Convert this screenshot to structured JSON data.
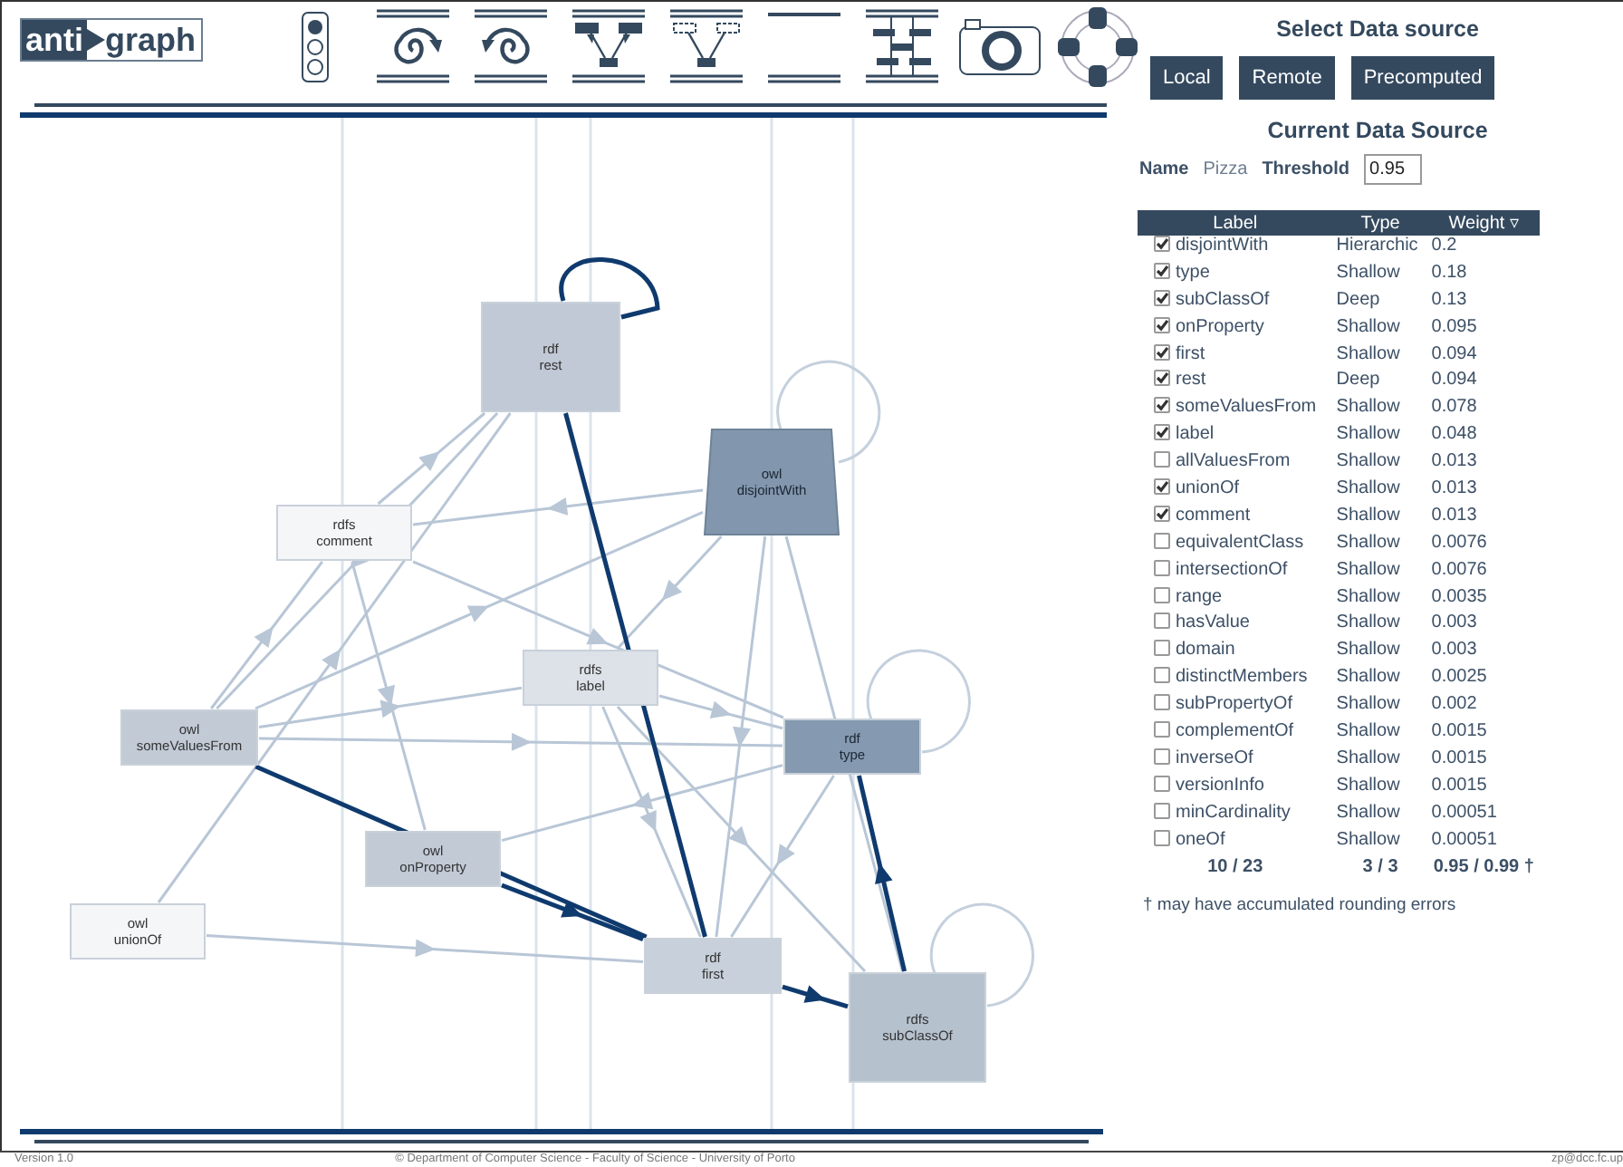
{
  "logo": {
    "parts": [
      "anti",
      "graph"
    ]
  },
  "toolbar": [
    {
      "kind": "traffic-light"
    },
    {
      "kind": "redo"
    },
    {
      "kind": "undo"
    },
    {
      "kind": "expand"
    },
    {
      "kind": "collapse"
    },
    {
      "kind": "blank"
    },
    {
      "kind": "layout"
    },
    {
      "kind": "camera"
    },
    {
      "kind": "lifebuoy"
    }
  ],
  "graph": {
    "nodes": [
      {
        "prefix": "rdf",
        "name": "rest",
        "kind": "rect",
        "color": "#c0c9d5"
      },
      {
        "prefix": "owl",
        "name": "disjointWith",
        "kind": "trapezoid",
        "color": "#8296ad"
      },
      {
        "prefix": "rdfs",
        "name": "comment",
        "kind": "rect",
        "color": "#f5f6f8"
      },
      {
        "prefix": "rdfs",
        "name": "label",
        "kind": "rect",
        "color": "#dde2e8"
      },
      {
        "prefix": "owl",
        "name": "someValuesFrom",
        "kind": "rect",
        "color": "#c2cad6"
      },
      {
        "prefix": "rdf",
        "name": "type",
        "kind": "rect",
        "color": "#8599b0"
      },
      {
        "prefix": "owl",
        "name": "onProperty",
        "kind": "rect",
        "color": "#c2cad6"
      },
      {
        "prefix": "owl",
        "name": "unionOf",
        "kind": "rect",
        "color": "#f5f6f8"
      },
      {
        "prefix": "rdf",
        "name": "first",
        "kind": "rect",
        "color": "#c8d0db"
      },
      {
        "prefix": "rdfs",
        "name": "subClassOf",
        "kind": "rect",
        "color": "#b6c1ce"
      }
    ]
  },
  "data_source": {
    "title": "Select Data source",
    "buttons": [
      "Local",
      "Remote",
      "Precomputed"
    ],
    "current_title": "Current Data Source",
    "name_label": "Name",
    "name_value": "Pizza",
    "threshold_label": "Threshold",
    "threshold_value": "0.95"
  },
  "table": {
    "columns": [
      "Label",
      "Type",
      "Weight ▿"
    ],
    "rows": [
      {
        "label": "disjointWith",
        "checked": true,
        "type": "Hierarchic",
        "weight": "0.2"
      },
      {
        "label": "type",
        "checked": true,
        "type": "Shallow",
        "weight": "0.18"
      },
      {
        "label": "subClassOf",
        "checked": true,
        "type": "Deep",
        "weight": "0.13"
      },
      {
        "label": "onProperty",
        "checked": true,
        "type": "Shallow",
        "weight": "0.095"
      },
      {
        "label": "first",
        "checked": true,
        "type": "Shallow",
        "weight": "0.094"
      },
      {
        "label": "rest",
        "checked": true,
        "type": "Deep",
        "weight": "0.094"
      },
      {
        "label": "someValuesFrom",
        "checked": true,
        "type": "Shallow",
        "weight": "0.078"
      },
      {
        "label": "label",
        "checked": true,
        "type": "Shallow",
        "weight": "0.048"
      },
      {
        "label": "allValuesFrom",
        "checked": false,
        "type": "Shallow",
        "weight": "0.013"
      },
      {
        "label": "unionOf",
        "checked": true,
        "type": "Shallow",
        "weight": "0.013"
      },
      {
        "label": "comment",
        "checked": true,
        "type": "Shallow",
        "weight": "0.013"
      },
      {
        "label": "equivalentClass",
        "checked": false,
        "type": "Shallow",
        "weight": "0.0076"
      },
      {
        "label": "intersectionOf",
        "checked": false,
        "type": "Shallow",
        "weight": "0.0076"
      },
      {
        "label": "range",
        "checked": false,
        "type": "Shallow",
        "weight": "0.0035"
      },
      {
        "label": "hasValue",
        "checked": false,
        "type": "Shallow",
        "weight": "0.003"
      },
      {
        "label": "domain",
        "checked": false,
        "type": "Shallow",
        "weight": "0.003"
      },
      {
        "label": "distinctMembers",
        "checked": false,
        "type": "Shallow",
        "weight": "0.0025"
      },
      {
        "label": "subPropertyOf",
        "checked": false,
        "type": "Shallow",
        "weight": "0.002"
      },
      {
        "label": "complementOf",
        "checked": false,
        "type": "Shallow",
        "weight": "0.0015"
      },
      {
        "label": "inverseOf",
        "checked": false,
        "type": "Shallow",
        "weight": "0.0015"
      },
      {
        "label": "versionInfo",
        "checked": false,
        "type": "Shallow",
        "weight": "0.0015"
      },
      {
        "label": "minCardinality",
        "checked": false,
        "type": "Shallow",
        "weight": "0.00051"
      },
      {
        "label": "oneOf",
        "checked": false,
        "type": "Shallow",
        "weight": "0.00051"
      }
    ],
    "totals": [
      "10 / 23",
      "3 / 3",
      "0.95 / 0.99 †"
    ]
  },
  "note": "† may have accumulated rounding errors",
  "footer": {
    "version": "Version 1.0",
    "copyright": "© Department of Computer Science - Faculty of Science - University of Porto",
    "contact": "zp@dcc.fc.up"
  }
}
